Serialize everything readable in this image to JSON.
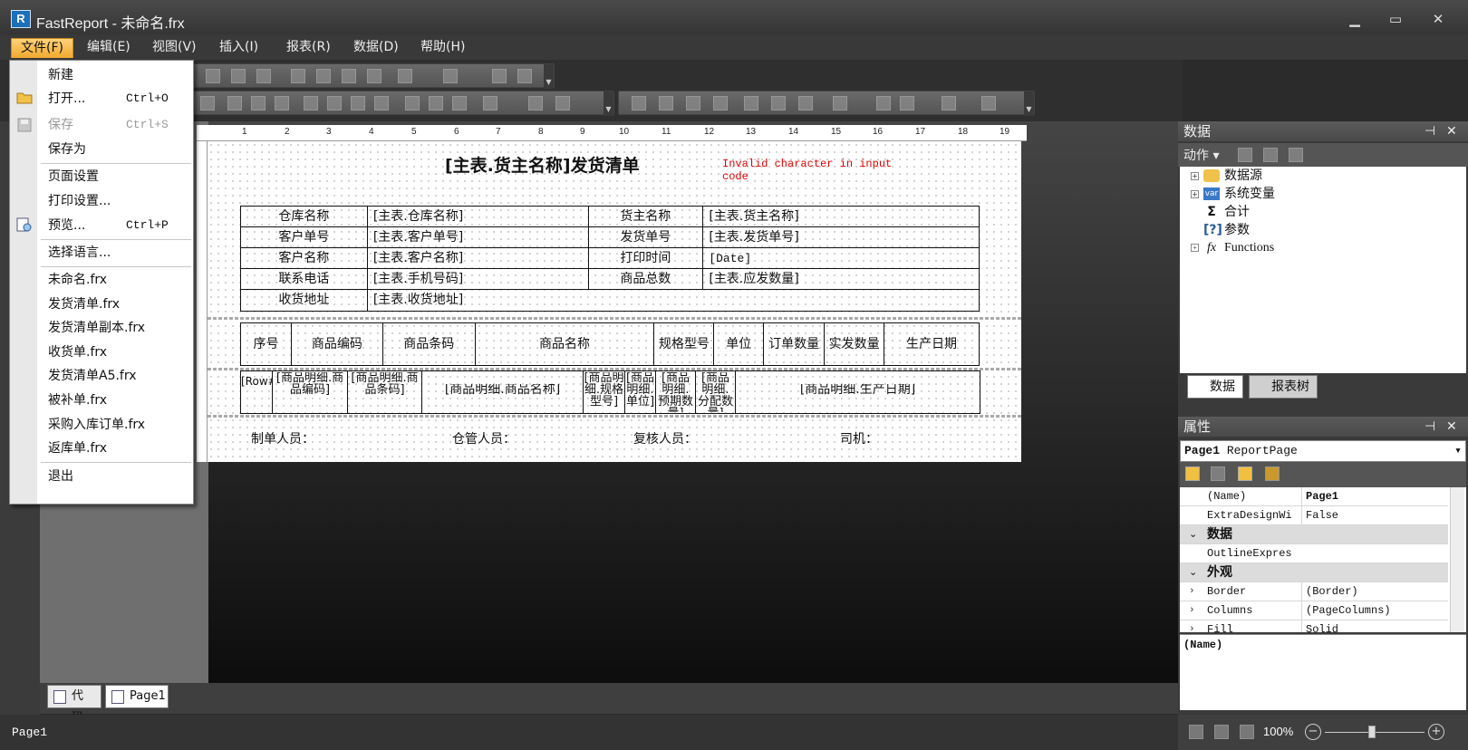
{
  "window": {
    "title": "FastReport - 未命名.frx",
    "icon_letter": "R",
    "minimize": "▁",
    "maximize": "▭",
    "close": "✕"
  },
  "menubar": [
    "文件(F)",
    "编辑(E)",
    "视图(V)",
    "插入(I)",
    "报表(R)",
    "数据(D)",
    "帮助(H)"
  ],
  "file_menu": {
    "new": "新建",
    "open": "打开...",
    "open_sc": "Ctrl+O",
    "save": "保存",
    "save_sc": "Ctrl+S",
    "save_as": "保存为",
    "page_setup": "页面设置",
    "print_setup": "打印设置...",
    "preview": "预览...",
    "preview_sc": "Ctrl+P",
    "language": "选择语言...",
    "recent": [
      "未命名.frx",
      "发货清单.frx",
      "发货清单副本.frx",
      "收货单.frx",
      "发货清单A5.frx",
      "被补单.frx",
      "采购入库订单.frx",
      "返库单.frx"
    ],
    "exit": "退出"
  },
  "ruler_ticks": [
    "1",
    "2",
    "3",
    "4",
    "5",
    "6",
    "7",
    "8",
    "9",
    "10",
    "11",
    "12",
    "13",
    "14",
    "15",
    "16",
    "17",
    "18",
    "19"
  ],
  "report": {
    "title": "[主表.货主名称]发货清单",
    "error": "Invalid character in input code",
    "header_rows": [
      [
        "仓库名称",
        "[主表.仓库名称]",
        "货主名称",
        "[主表.货主名称]"
      ],
      [
        "客户单号",
        "[主表.客户单号]",
        "发货单号",
        "[主表.发货单号]"
      ],
      [
        "客户名称",
        "[主表.客户名称]",
        "打印时间",
        "[Date]"
      ],
      [
        "联系电话",
        "[主表.手机号码]",
        "商品总数",
        "[主表.应发数量]"
      ]
    ],
    "address_label": "收货地址",
    "address_value": "[主表.收货地址]",
    "columns": [
      "序号",
      "商品编码",
      "商品条码",
      "商品名称",
      "规格型号",
      "单位",
      "订单数量",
      "实发数量",
      "生产日期"
    ],
    "detail": [
      "[Row#]",
      "[商品明细.商品编码]",
      "[商品明细.商品条码]",
      "[商品明细.商品名称]",
      "[商品明细.规格型号]",
      "[商品明细.单位]",
      "[商品明细.预期数量]",
      "[商品明细.分配数量]",
      "[商品明细.生产日期]"
    ],
    "footer": [
      "制单人员：",
      "仓管人员：",
      "复核人员：",
      "司机："
    ]
  },
  "doc_tabs": [
    "代码",
    "Page1"
  ],
  "status": "Page1",
  "data_panel": {
    "title": "数据",
    "actions": "动作",
    "tree": [
      "数据源",
      "系统变量",
      "合计",
      "参数",
      "Functions"
    ],
    "tabs": [
      "数据",
      "报表树"
    ]
  },
  "props_panel": {
    "title": "属性",
    "object": "Page1",
    "object_type": "ReportPage",
    "rows": [
      {
        "name": "(Name)",
        "value": "Page1"
      },
      {
        "name": "ExtraDesignWi",
        "value": "False"
      },
      {
        "name": "数据",
        "cat": true
      },
      {
        "name": "OutlineExpres",
        "value": ""
      },
      {
        "name": "外观",
        "cat": true
      },
      {
        "name": "Border",
        "value": "(Border)"
      },
      {
        "name": "Columns",
        "value": "(PageColumns)"
      },
      {
        "name": "Fill",
        "value": "Solid"
      }
    ],
    "description": "(Name)"
  },
  "zoom": "100%"
}
